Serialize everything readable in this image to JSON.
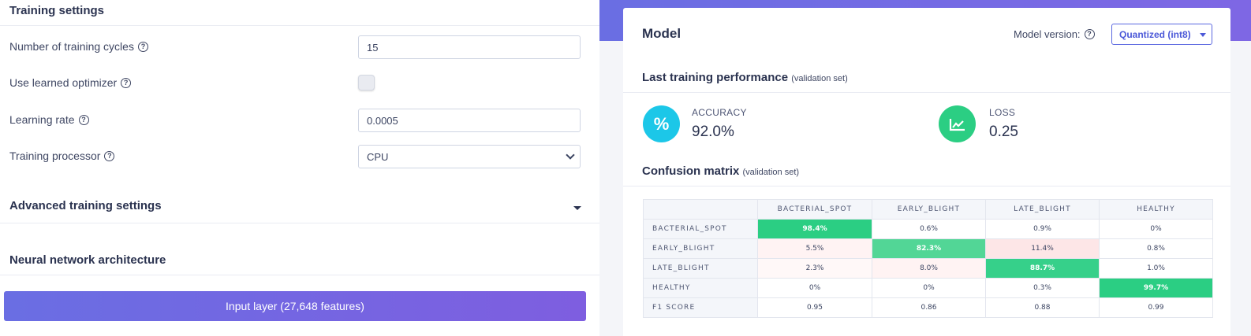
{
  "training_settings": {
    "title": "Training settings",
    "cycles_label": "Number of training cycles",
    "cycles_value": "15",
    "optimizer_label": "Use learned optimizer",
    "optimizer_checked": false,
    "lr_label": "Learning rate",
    "lr_value": "0.0005",
    "processor_label": "Training processor",
    "processor_value": "CPU",
    "advanced_label": "Advanced training settings",
    "nn_label": "Neural network architecture",
    "input_layer_label": "Input layer (27,648 features)"
  },
  "model": {
    "title": "Model",
    "version_label": "Model version:",
    "version_value": "Quantized (int8)",
    "perf_title": "Last training performance",
    "perf_note": "(validation set)",
    "accuracy_label": "ACCURACY",
    "accuracy_value": "92.0%",
    "loss_label": "LOSS",
    "loss_value": "0.25",
    "cm_title": "Confusion matrix",
    "cm_note": "(validation set)"
  },
  "confusion_matrix": {
    "columns": [
      "BACTERIAL_SPOT",
      "EARLY_BLIGHT",
      "LATE_BLIGHT",
      "HEALTHY"
    ],
    "rows": [
      {
        "label": "BACTERIAL_SPOT",
        "values": [
          "98.4%",
          "0.6%",
          "0.9%",
          "0%"
        ]
      },
      {
        "label": "EARLY_BLIGHT",
        "values": [
          "5.5%",
          "82.3%",
          "11.4%",
          "0.8%"
        ]
      },
      {
        "label": "LATE_BLIGHT",
        "values": [
          "2.3%",
          "8.0%",
          "88.7%",
          "1.0%"
        ]
      },
      {
        "label": "HEALTHY",
        "values": [
          "0%",
          "0%",
          "0.3%",
          "99.7%"
        ]
      },
      {
        "label": "F1 SCORE",
        "values": [
          "0.95",
          "0.86",
          "0.88",
          "0.99"
        ]
      }
    ]
  },
  "colors": {
    "accent": "#6a6ee3",
    "accuracy_circle": "#1cc7e8",
    "loss_circle": "#2bce83",
    "matrix_green": "#2bce83"
  },
  "icons": {
    "help": "question-circle-icon",
    "accuracy": "percent-icon",
    "loss": "chart-line-icon"
  }
}
